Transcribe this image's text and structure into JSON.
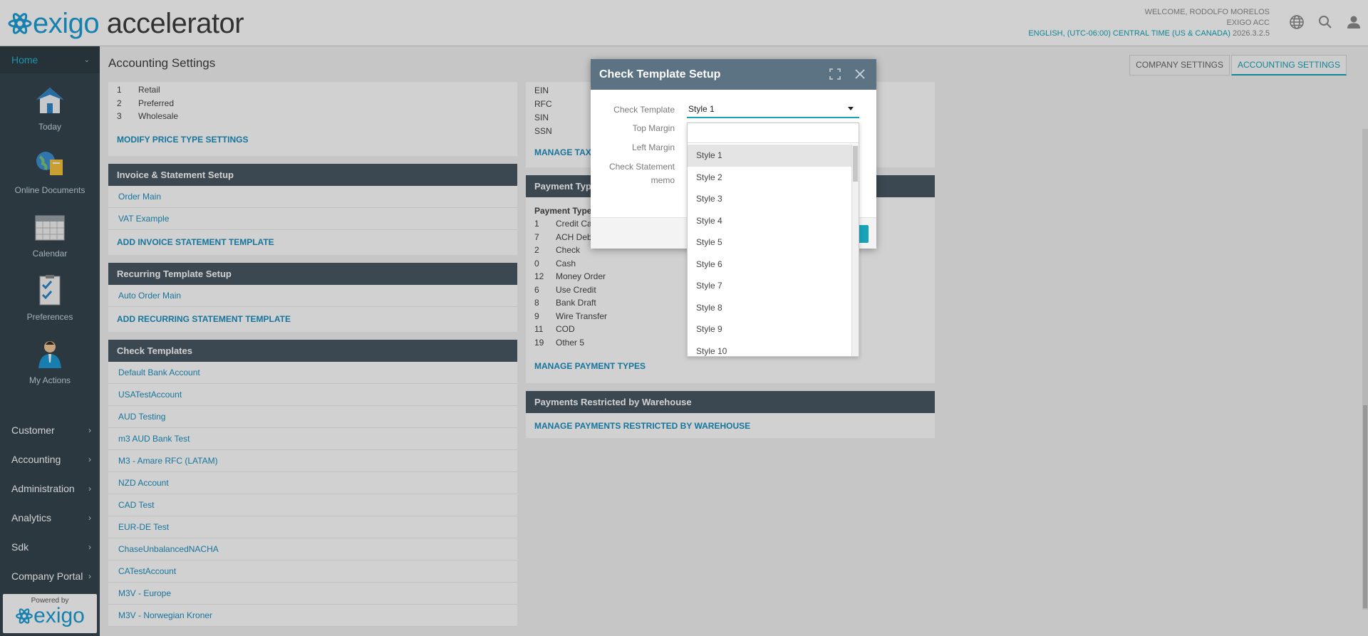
{
  "header": {
    "logo_brand": "exigo",
    "logo_product": "accelerator",
    "welcome": "WELCOME, RODOLFO MORELOS",
    "company": "EXIGO ACC",
    "locale": "ENGLISH, (UTC-06:00) CENTRAL TIME (US & CANADA)",
    "version": "2026.3.2.5",
    "icons": [
      "globe-icon",
      "search-icon",
      "user-icon"
    ]
  },
  "sidebar": {
    "home": "Home",
    "tiles": [
      {
        "label": "Today",
        "icon": "house-icon"
      },
      {
        "label": "Online Documents",
        "icon": "globe-folder-icon"
      },
      {
        "label": "Calendar",
        "icon": "calendar-icon"
      },
      {
        "label": "Preferences",
        "icon": "checklist-icon"
      },
      {
        "label": "My Actions",
        "icon": "person-icon"
      }
    ],
    "menu": [
      "Customer",
      "Accounting",
      "Administration",
      "Analytics",
      "Sdk",
      "Company Portal"
    ],
    "powered_by": "Powered by",
    "powered_brand": "exigo"
  },
  "page": {
    "title": "Accounting Settings",
    "tabs": [
      "COMPANY SETTINGS",
      "ACCOUNTING SETTINGS"
    ],
    "active_tab": "ACCOUNTING SETTINGS"
  },
  "price_types": {
    "rows": [
      {
        "num": "1",
        "name": "Retail"
      },
      {
        "num": "2",
        "name": "Preferred"
      },
      {
        "num": "3",
        "name": "Wholesale"
      }
    ],
    "action": "MODIFY PRICE TYPE SETTINGS"
  },
  "invoice": {
    "title": "Invoice & Statement Setup",
    "rows": [
      "Order Main",
      "VAT Example"
    ],
    "action": "ADD INVOICE STATEMENT TEMPLATE"
  },
  "recurring": {
    "title": "Recurring Template Setup",
    "rows": [
      "Auto Order Main"
    ],
    "action": "ADD RECURRING STATEMENT TEMPLATE"
  },
  "check_templates": {
    "title": "Check Templates",
    "rows": [
      "Default Bank Account",
      "USATestAccount",
      "AUD Testing",
      "m3 AUD Bank Test",
      "M3 - Amare RFC (LATAM)",
      "NZD Account",
      "CAD Test",
      "EUR-DE Test",
      "ChaseUnbalancedNACHA",
      "CATestAccount",
      "M3V - Europe",
      "M3V - Norwegian Kroner"
    ]
  },
  "tax": {
    "rows": [
      "EIN",
      "RFC",
      "SIN",
      "SSN"
    ],
    "action": "MANAGE TAX T"
  },
  "payment_types": {
    "title": "Payment Type",
    "sub_title": "Payment Type",
    "rows": [
      {
        "num": "1",
        "name": "Credit Ca"
      },
      {
        "num": "7",
        "name": "ACH Deb"
      },
      {
        "num": "2",
        "name": "Check"
      },
      {
        "num": "0",
        "name": "Cash"
      },
      {
        "num": "12",
        "name": "Money Order"
      },
      {
        "num": "6",
        "name": "Use Credit"
      },
      {
        "num": "8",
        "name": "Bank Draft"
      },
      {
        "num": "9",
        "name": "Wire Transfer"
      },
      {
        "num": "11",
        "name": "COD"
      },
      {
        "num": "19",
        "name": "Other 5"
      }
    ],
    "action": "MANAGE PAYMENT TYPES"
  },
  "restricted": {
    "title": "Payments Restricted by Warehouse",
    "action": "MANAGE PAYMENTS RESTRICTED BY WAREHOUSE"
  },
  "modal": {
    "title": "Check Template Setup",
    "fields": {
      "check_template_label": "Check Template",
      "check_template_value": "Style 1",
      "top_margin_label": "Top Margin",
      "left_margin_label": "Left Margin",
      "memo_label_1": "Check Statement",
      "memo_label_2": "memo"
    },
    "dropdown_options": [
      "Style 1",
      "Style 2",
      "Style 3",
      "Style 4",
      "Style 5",
      "Style 6",
      "Style 7",
      "Style 8",
      "Style 9",
      "Style 10"
    ],
    "dropdown_highlighted": "Style 1"
  },
  "colors": {
    "accent": "#17a3b8",
    "link": "#1d8fbf",
    "sidebar": "#36454f",
    "panel_header": "#4a5863",
    "modal_header": "#5c7383"
  }
}
